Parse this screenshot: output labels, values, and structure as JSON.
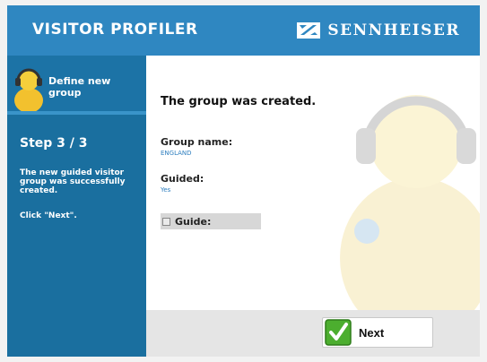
{
  "header": {
    "app_title": "VISITOR PROFILER",
    "brand": "SENNHEISER"
  },
  "sidebar": {
    "heading": "Define new group",
    "step": "Step 3 / 3",
    "description": "The new guided visitor group was successfully created.",
    "hint": "Click \"Next\"."
  },
  "content": {
    "message": "The group was created.",
    "group_name_label": "Group name:",
    "group_name_value": "ENGLAND",
    "guided_label": "Guided:",
    "guided_value": "Yes",
    "guide_label": "Guide:"
  },
  "footer": {
    "next_label": "Next"
  },
  "colors": {
    "header_blue": "#2f87c1",
    "sidebar_blue": "#1a6f9f",
    "value_blue": "#2f7fbf",
    "check_green": "#4cae2f"
  }
}
